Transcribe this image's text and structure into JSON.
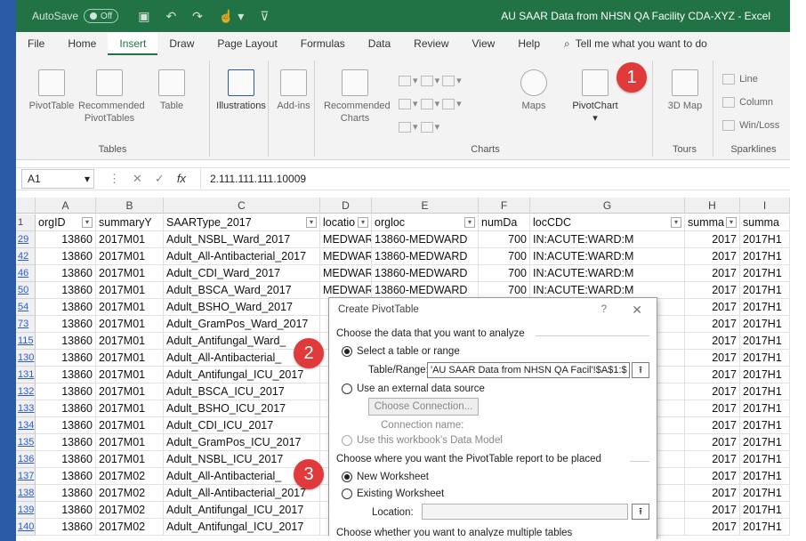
{
  "colors": {
    "excel_green": "#217346",
    "window_blue": "#2b5aa6",
    "badge_red": "#e03a3a",
    "row_link": "#2a5bd6"
  },
  "titlebar": {
    "autosave_label": "AutoSave",
    "autosave_state": "Off",
    "title": "AU SAAR Data from NHSN QA Facility CDA-XYZ  -  Excel"
  },
  "menu": {
    "tabs": [
      "File",
      "Home",
      "Insert",
      "Draw",
      "Page Layout",
      "Formulas",
      "Data",
      "Review",
      "View",
      "Help"
    ],
    "active": "Insert",
    "tell_me": "Tell me what you want to do"
  },
  "ribbon": {
    "tables_group": "Tables",
    "pivottable": "PivotTable",
    "recommended_pivottables": "Recommended PivotTables",
    "table": "Table",
    "illustrations": "Illustrations",
    "addins": "Add-ins",
    "recommended_charts": "Recommended Charts",
    "maps": "Maps",
    "pivotchart": "PivotChart",
    "charts_group": "Charts",
    "map3d": "3D Map",
    "tours_group": "Tours",
    "line": "Line",
    "column": "Column",
    "winloss": "Win/Loss",
    "sparklines_group": "Sparklines"
  },
  "badges": [
    "1",
    "2",
    "3"
  ],
  "formula_bar": {
    "cell_ref": "A1",
    "fx": "fx",
    "value": "2.111.111.111.10009"
  },
  "columns": [
    "A",
    "B",
    "C",
    "D",
    "E",
    "F",
    "G",
    "H",
    "I"
  ],
  "header_row": [
    "orgID",
    "summaryY",
    "SAARType_2017",
    "locatio",
    "orgloc",
    "numDa",
    "locCDC",
    "summa",
    "summa"
  ],
  "rows": [
    {
      "n": "29",
      "a": "13860",
      "b": "2017M01",
      "c": "Adult_NSBL_Ward_2017",
      "d": "MEDWARI",
      "e": "13860-MEDWARD",
      "f": "700",
      "g": "IN:ACUTE:WARD:M",
      "h": "2017",
      "i": "2017H1"
    },
    {
      "n": "42",
      "a": "13860",
      "b": "2017M01",
      "c": "Adult_All-Antibacterial_2017",
      "d": "MEDWARI",
      "e": "13860-MEDWARD",
      "f": "700",
      "g": "IN:ACUTE:WARD:M",
      "h": "2017",
      "i": "2017H1"
    },
    {
      "n": "46",
      "a": "13860",
      "b": "2017M01",
      "c": "Adult_CDI_Ward_2017",
      "d": "MEDWARI",
      "e": "13860-MEDWARD",
      "f": "700",
      "g": "IN:ACUTE:WARD:M",
      "h": "2017",
      "i": "2017H1"
    },
    {
      "n": "50",
      "a": "13860",
      "b": "2017M01",
      "c": "Adult_BSCA_Ward_2017",
      "d": "MEDWARI",
      "e": "13860-MEDWARD",
      "f": "700",
      "g": "IN:ACUTE:WARD:M",
      "h": "2017",
      "i": "2017H1"
    },
    {
      "n": "54",
      "a": "13860",
      "b": "2017M01",
      "c": "Adult_BSHO_Ward_2017",
      "d": "",
      "e": "",
      "f": "",
      "g": "",
      "h": "2017",
      "i": "2017H1"
    },
    {
      "n": "73",
      "a": "13860",
      "b": "2017M01",
      "c": "Adult_GramPos_Ward_2017",
      "d": "",
      "e": "",
      "f": "",
      "g": "",
      "h": "2017",
      "i": "2017H1"
    },
    {
      "n": "115",
      "a": "13860",
      "b": "2017M01",
      "c": "Adult_Antifungal_Ward_",
      "d": "",
      "e": "",
      "f": "",
      "g": "",
      "h": "2017",
      "i": "2017H1"
    },
    {
      "n": "130",
      "a": "13860",
      "b": "2017M01",
      "c": "Adult_All-Antibacterial_",
      "d": "",
      "e": "",
      "f": "",
      "g": "",
      "h": "2017",
      "i": "2017H1"
    },
    {
      "n": "131",
      "a": "13860",
      "b": "2017M01",
      "c": "Adult_Antifungal_ICU_2017",
      "d": "",
      "e": "",
      "f": "",
      "g": "",
      "h": "2017",
      "i": "2017H1"
    },
    {
      "n": "132",
      "a": "13860",
      "b": "2017M01",
      "c": "Adult_BSCA_ICU_2017",
      "d": "",
      "e": "",
      "f": "",
      "g": "",
      "h": "2017",
      "i": "2017H1"
    },
    {
      "n": "133",
      "a": "13860",
      "b": "2017M01",
      "c": "Adult_BSHO_ICU_2017",
      "d": "",
      "e": "",
      "f": "",
      "g": "",
      "h": "2017",
      "i": "2017H1"
    },
    {
      "n": "134",
      "a": "13860",
      "b": "2017M01",
      "c": "Adult_CDI_ICU_2017",
      "d": "",
      "e": "",
      "f": "",
      "g": "",
      "h": "2017",
      "i": "2017H1"
    },
    {
      "n": "135",
      "a": "13860",
      "b": "2017M01",
      "c": "Adult_GramPos_ICU_2017",
      "d": "",
      "e": "",
      "f": "",
      "g": "",
      "h": "2017",
      "i": "2017H1"
    },
    {
      "n": "136",
      "a": "13860",
      "b": "2017M01",
      "c": "Adult_NSBL_ICU_2017",
      "d": "",
      "e": "",
      "f": "",
      "g": "",
      "h": "2017",
      "i": "2017H1"
    },
    {
      "n": "137",
      "a": "13860",
      "b": "2017M02",
      "c": "Adult_All-Antibacterial_",
      "d": "",
      "e": "",
      "f": "",
      "g": "",
      "h": "2017",
      "i": "2017H1"
    },
    {
      "n": "138",
      "a": "13860",
      "b": "2017M02",
      "c": "Adult_All-Antibacterial_2017",
      "d": "",
      "e": "",
      "f": "",
      "g": "",
      "h": "2017",
      "i": "2017H1"
    },
    {
      "n": "139",
      "a": "13860",
      "b": "2017M02",
      "c": "Adult_Antifungal_ICU_2017",
      "d": "",
      "e": "",
      "f": "",
      "g": "",
      "h": "2017",
      "i": "2017H1"
    },
    {
      "n": "140",
      "a": "13860",
      "b": "2017M02",
      "c": "Adult_Antifungal_ICU_2017",
      "d": "",
      "e": "",
      "f": "",
      "g": "",
      "h": "2017",
      "i": "2017H1"
    }
  ],
  "dialog": {
    "title": "Create PivotTable",
    "help": "?",
    "close": "✕",
    "choose_data": "Choose the data that you want to analyze",
    "select_table": "Select a table or range",
    "table_range_label": "Table/Range:",
    "table_range_value": "'AU SAAR Data from NHSN QA Facil'!$A$1:$",
    "use_external": "Use an external data source",
    "choose_connection": "Choose Connection...",
    "connection_name": "Connection name:",
    "use_data_model": "Use this workbook's Data Model",
    "choose_where": "Choose where you want the PivotTable report to be placed",
    "new_worksheet": "New Worksheet",
    "existing_worksheet": "Existing Worksheet",
    "location_label": "Location:",
    "choose_multiple": "Choose whether you want to analyze multiple tables"
  }
}
